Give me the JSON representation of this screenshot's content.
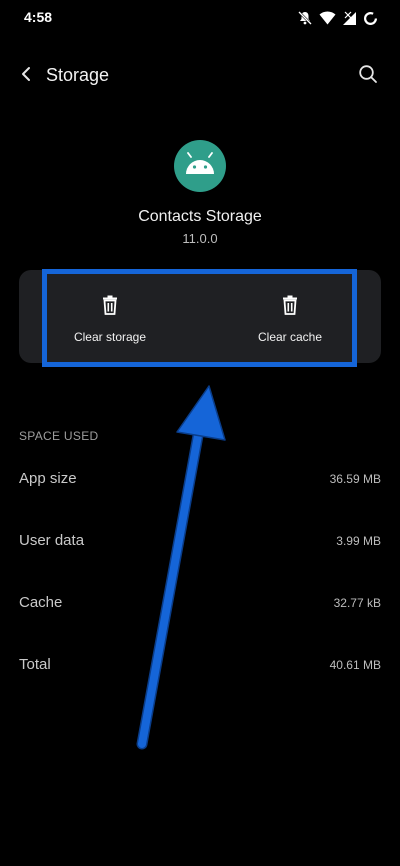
{
  "status_bar": {
    "time": "4:58",
    "icons": [
      "mute-icon",
      "wifi-icon",
      "signal-icon",
      "sync-icon"
    ]
  },
  "app_bar": {
    "title": "Storage",
    "back_icon": "back-arrow-icon",
    "search_icon": "search-icon"
  },
  "app": {
    "icon": "android-icon",
    "name": "Contacts Storage",
    "version": "11.0.0",
    "icon_color": "#2f9e8a"
  },
  "actions": [
    {
      "label": "Clear storage",
      "icon": "trash-icon"
    },
    {
      "label": "Clear cache",
      "icon": "trash-icon"
    }
  ],
  "space_used": {
    "header": "SPACE USED",
    "rows": [
      {
        "label": "App size",
        "value": "36.59 MB"
      },
      {
        "label": "User data",
        "value": "3.99 MB"
      },
      {
        "label": "Cache",
        "value": "32.77 kB"
      },
      {
        "label": "Total",
        "value": "40.61 MB"
      }
    ]
  },
  "annotation": {
    "color": "#1565d8"
  }
}
